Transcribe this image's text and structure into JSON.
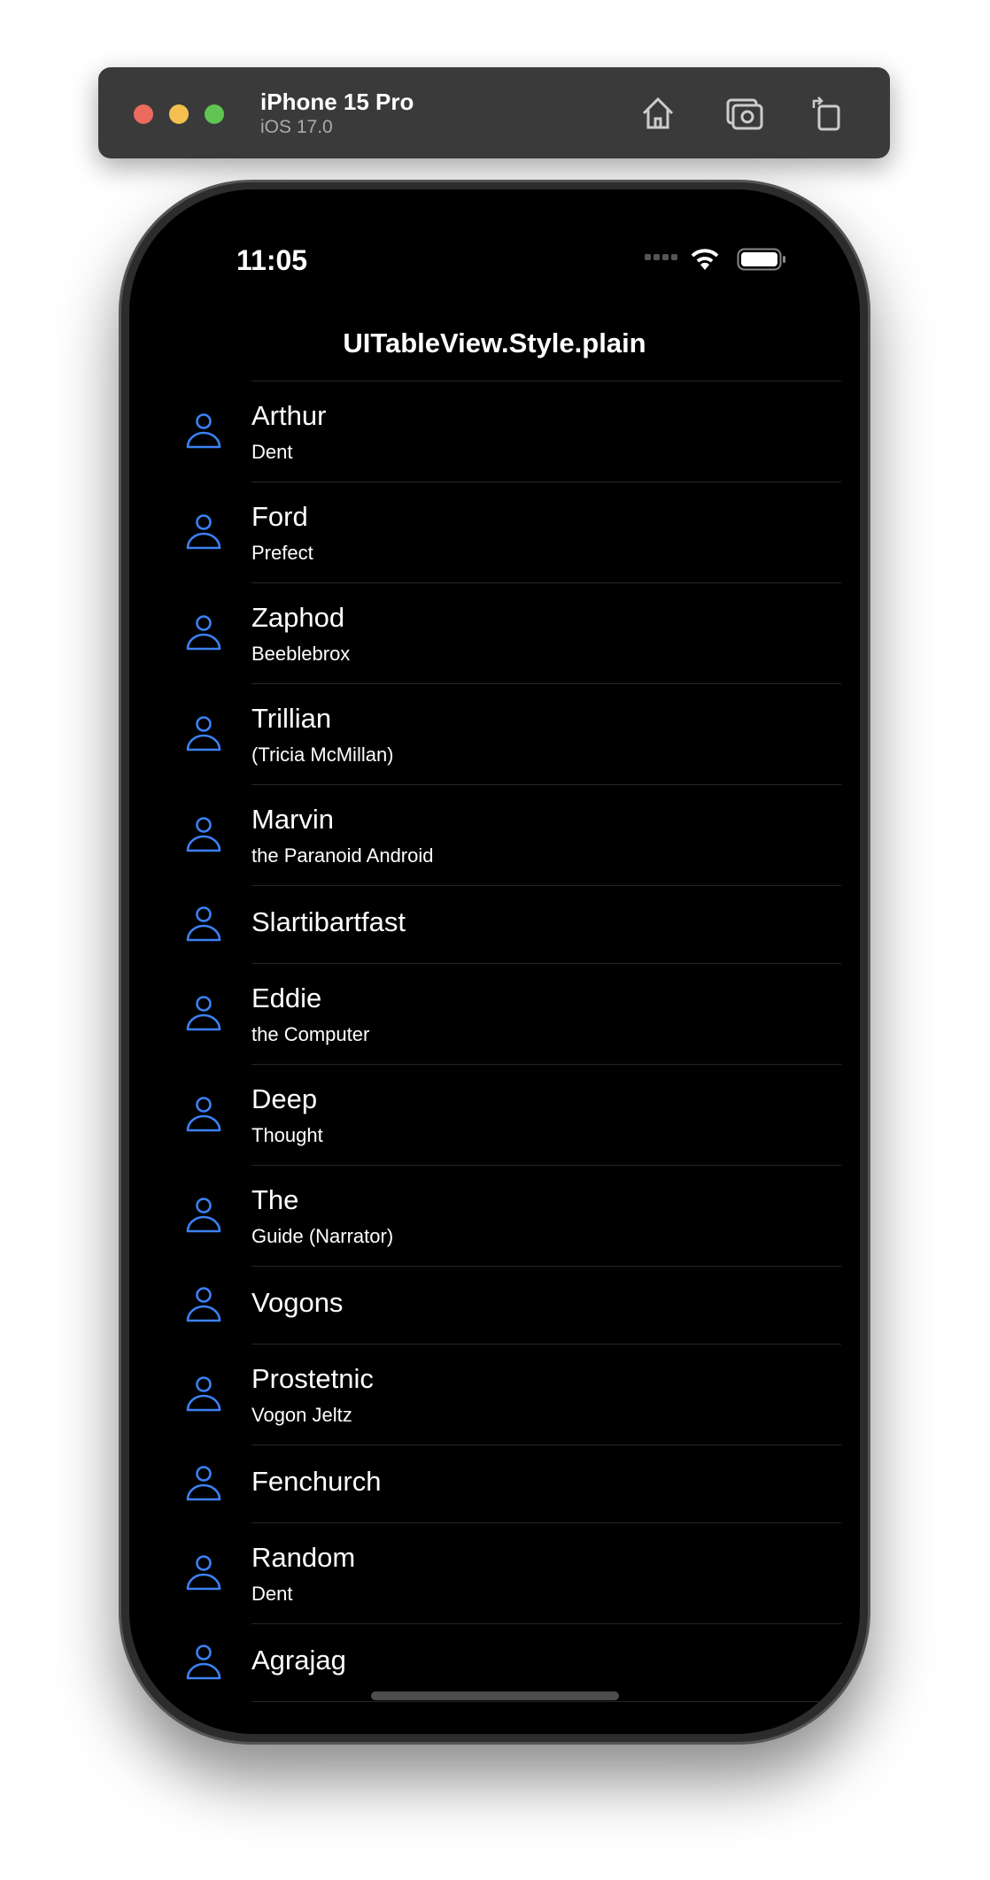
{
  "window": {
    "device": "iPhone 15 Pro",
    "os": "iOS 17.0",
    "buttons": [
      "home-icon",
      "screenshot-icon",
      "rotate-icon"
    ],
    "traffic_lights": {
      "close": "#ec6a5e",
      "minimize": "#f4bf4f",
      "zoom": "#61c554"
    }
  },
  "status_bar": {
    "time": "11:05"
  },
  "nav": {
    "title": "UITableView.Style.plain"
  },
  "accent": "#3b82f6",
  "rows": [
    {
      "title": "Arthur",
      "subtitle": "Dent"
    },
    {
      "title": "Ford",
      "subtitle": "Prefect"
    },
    {
      "title": "Zaphod",
      "subtitle": "Beeblebrox"
    },
    {
      "title": "Trillian",
      "subtitle": "(Tricia McMillan)"
    },
    {
      "title": "Marvin",
      "subtitle": "the Paranoid Android"
    },
    {
      "title": "Slartibartfast",
      "subtitle": ""
    },
    {
      "title": "Eddie",
      "subtitle": "the Computer"
    },
    {
      "title": "Deep",
      "subtitle": "Thought"
    },
    {
      "title": "The",
      "subtitle": "Guide (Narrator)"
    },
    {
      "title": "Vogons",
      "subtitle": ""
    },
    {
      "title": "Prostetnic",
      "subtitle": "Vogon Jeltz"
    },
    {
      "title": "Fenchurch",
      "subtitle": ""
    },
    {
      "title": "Random",
      "subtitle": "Dent"
    },
    {
      "title": "Agrajag",
      "subtitle": ""
    }
  ]
}
